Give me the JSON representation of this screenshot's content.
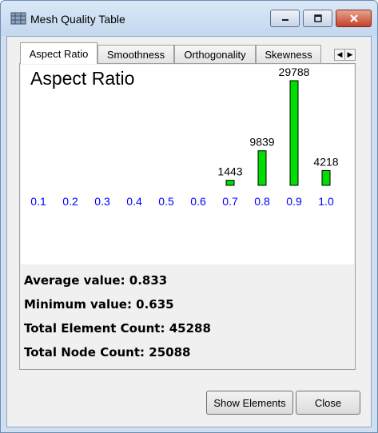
{
  "window": {
    "title": "Mesh Quality Table",
    "controls": {
      "minimize": "minimize-icon",
      "maximize": "maximize-icon",
      "close": "close-icon"
    }
  },
  "tabs": [
    {
      "label": "Aspect Ratio",
      "active": true
    },
    {
      "label": "Smoothness",
      "active": false
    },
    {
      "label": "Orthogonality",
      "active": false
    },
    {
      "label": "Skewness",
      "active": false
    }
  ],
  "chart_data": {
    "type": "bar",
    "title": "Aspect Ratio",
    "categories": [
      "0.1",
      "0.2",
      "0.3",
      "0.4",
      "0.5",
      "0.6",
      "0.7",
      "0.8",
      "0.9",
      "1.0"
    ],
    "values": [
      0,
      0,
      0,
      0,
      0,
      0,
      1443,
      9839,
      29788,
      4218
    ],
    "ylim": [
      0,
      29788
    ],
    "grid": false,
    "bar_color": "#00dd00",
    "label_color": "#0000ff"
  },
  "stats": {
    "average": "Average value: 0.833",
    "minimum": "Minimum value: 0.635",
    "elements": "Total Element Count: 45288",
    "nodes": "Total Node Count: 25088"
  },
  "buttons": {
    "show_elements": "Show Elements",
    "close": "Close"
  }
}
